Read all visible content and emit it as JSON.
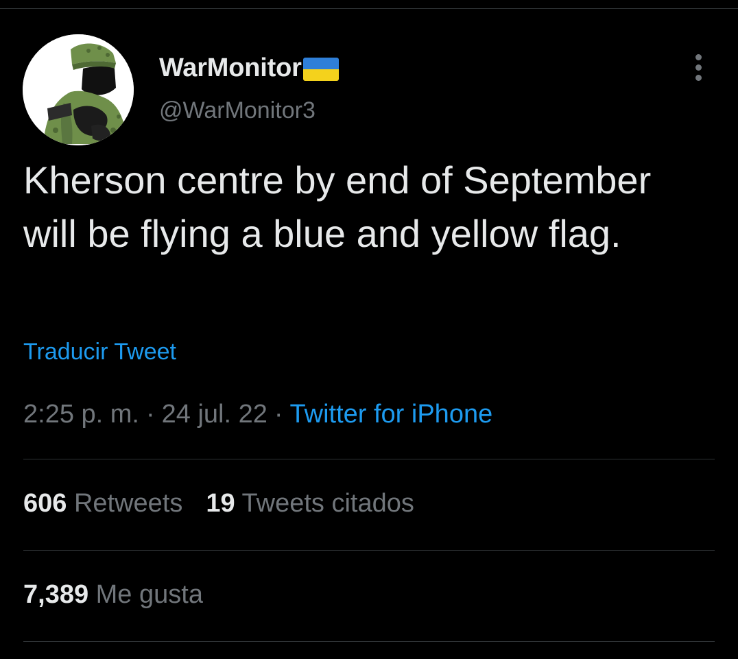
{
  "author": {
    "display_name": "WarMonitor",
    "handle": "@WarMonitor3",
    "avatar_icon": "soldier-avatar",
    "flag_icon": "ukraine-flag-icon",
    "flag_colors": [
      "#2f7fd8",
      "#f4d21c"
    ]
  },
  "tweet": {
    "text": "Kherson centre by end of September will be flying a blue and yellow flag.",
    "translate_label": "Traducir Tweet",
    "time": "2:25 p. m.",
    "date": "24 jul. 22",
    "separator": "·",
    "source": "Twitter for iPhone"
  },
  "stats": {
    "retweets_count": "606",
    "retweets_label": "Retweets",
    "quotes_count": "19",
    "quotes_label": "Tweets citados",
    "likes_count": "7,389",
    "likes_label": "Me gusta"
  },
  "menu": {
    "icon": "more-options-icon"
  },
  "colors": {
    "background": "#000000",
    "text": "#e7e9ea",
    "secondary": "#71767b",
    "link": "#1d9bf0",
    "divider": "#2f3336"
  }
}
